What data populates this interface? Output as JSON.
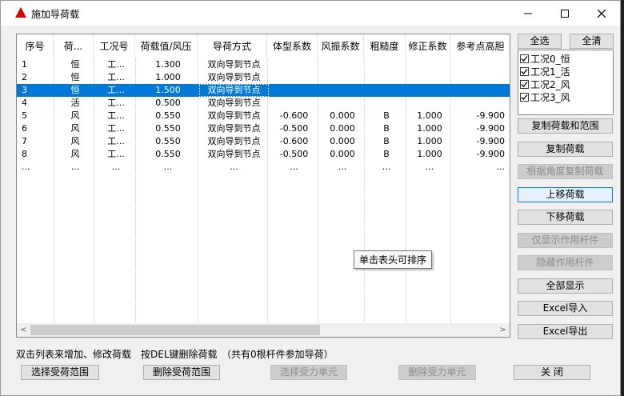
{
  "window": {
    "title": "施加导荷载",
    "app_icon": "autocad-triangle-icon",
    "controls": [
      "minimize-icon",
      "maximize-icon",
      "close-icon"
    ]
  },
  "table": {
    "columns": [
      "序号",
      "荷...",
      "工况号",
      "荷载值/风压",
      "导荷方式",
      "体型系数",
      "风振系数",
      "粗糙度",
      "修正系数",
      "参考点高胆"
    ],
    "rows": [
      {
        "no": "1",
        "type": "恒",
        "case": "工...",
        "value": "1.300",
        "mode": "双向导到节点",
        "shape": "",
        "vibration": "",
        "rough": "",
        "corr": "",
        "ref": ""
      },
      {
        "no": "2",
        "type": "恒",
        "case": "工...",
        "value": "1.000",
        "mode": "双向导到节点",
        "shape": "",
        "vibration": "",
        "rough": "",
        "corr": "",
        "ref": ""
      },
      {
        "no": "3",
        "type": "恒",
        "case": "工...",
        "value": "1.500",
        "mode": "双向导到节点",
        "shape": "",
        "vibration": "",
        "rough": "",
        "corr": "",
        "ref": ""
      },
      {
        "no": "4",
        "type": "活",
        "case": "工...",
        "value": "0.500",
        "mode": "双向导到节点",
        "shape": "",
        "vibration": "",
        "rough": "",
        "corr": "",
        "ref": ""
      },
      {
        "no": "5",
        "type": "风",
        "case": "工...",
        "value": "0.550",
        "mode": "双向导到节点",
        "shape": "-0.600",
        "vibration": "0.000",
        "rough": "B",
        "corr": "1.000",
        "ref": "-9.900"
      },
      {
        "no": "6",
        "type": "风",
        "case": "工...",
        "value": "0.550",
        "mode": "双向导到节点",
        "shape": "-0.500",
        "vibration": "0.000",
        "rough": "B",
        "corr": "1.000",
        "ref": "-9.900"
      },
      {
        "no": "7",
        "type": "风",
        "case": "工...",
        "value": "0.550",
        "mode": "双向导到节点",
        "shape": "-0.600",
        "vibration": "0.000",
        "rough": "B",
        "corr": "1.000",
        "ref": "-9.900"
      },
      {
        "no": "8",
        "type": "风",
        "case": "工...",
        "value": "0.550",
        "mode": "双向导到节点",
        "shape": "-0.500",
        "vibration": "0.000",
        "rough": "B",
        "corr": "1.000",
        "ref": "-9.900"
      },
      {
        "no": "...",
        "type": "...",
        "case": "...",
        "value": "...",
        "mode": "...",
        "shape": "...",
        "vibration": "...",
        "rough": "...",
        "corr": "...",
        "ref": "..."
      }
    ],
    "selected_row": 3,
    "tooltip": "单击表头可排序",
    "scroll_left": "<",
    "scroll_right": ">"
  },
  "right_panel": {
    "select_all": "全选",
    "clear_all": "全清",
    "cases": [
      {
        "label": "工况0_恒",
        "checked": true
      },
      {
        "label": "工况1_活",
        "checked": true
      },
      {
        "label": "工况2_风",
        "checked": true
      },
      {
        "label": "工况3_风",
        "checked": true
      }
    ],
    "buttons": [
      {
        "label": "复制荷载和范围",
        "enabled": true
      },
      {
        "label": "复制荷载",
        "enabled": true
      },
      {
        "label": "根据角度复制荷载",
        "enabled": false
      },
      {
        "label": "上移荷载",
        "enabled": true
      },
      {
        "label": "下移荷载",
        "enabled": true
      },
      {
        "label": "仅显示作用杆件",
        "enabled": false
      },
      {
        "label": "隐藏作用杆件",
        "enabled": false
      },
      {
        "label": "全部显示",
        "enabled": true
      },
      {
        "label": "Excel导入",
        "enabled": true
      },
      {
        "label": "Excel导出",
        "enabled": true
      }
    ]
  },
  "hints": {
    "hint1": "双击列表来增加、修改荷载",
    "hint2": "按DEL键删除荷载",
    "hint3": "（共有0根杆件参加导荷）"
  },
  "bottom_buttons": {
    "select_range": "选择受荷范围",
    "delete_range": "删除受荷范围",
    "select_unit": "选择受力单元",
    "delete_unit": "删除受力单元",
    "close": "关 闭"
  },
  "colors": {
    "selection": "#0078d7",
    "dialog_bg": "#f0f0f0",
    "focus_border": "#0078d7"
  }
}
